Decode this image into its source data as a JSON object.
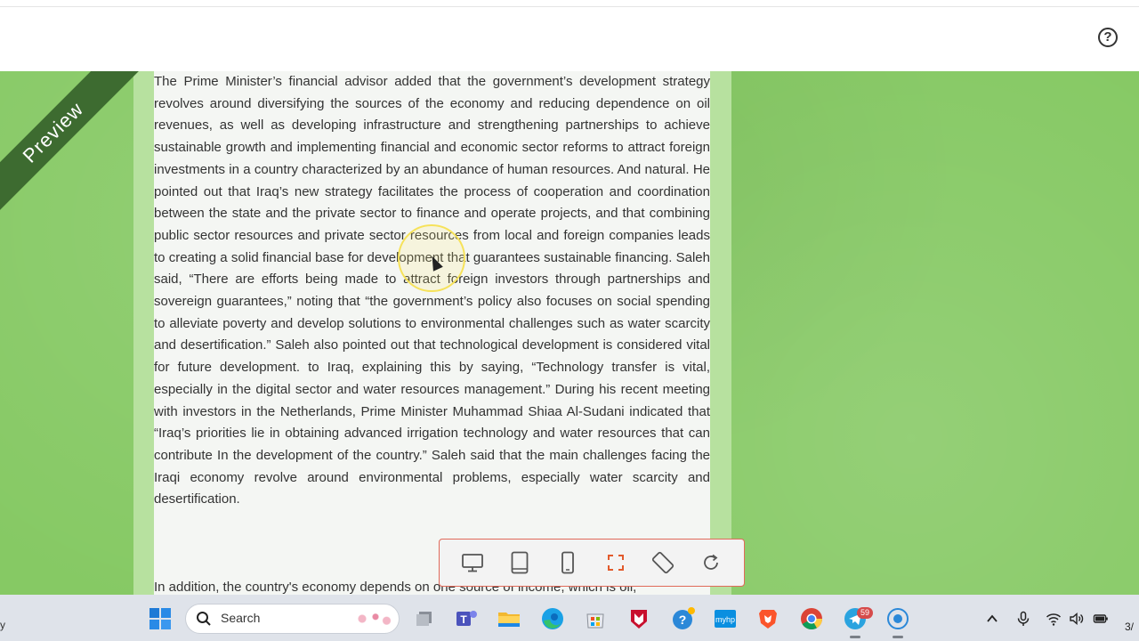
{
  "header": {
    "help_icon": "question-circle-icon",
    "help_glyph": "?"
  },
  "preview": {
    "ribbon_label": "Preview",
    "paragraph_1": "The Prime Minister’s financial advisor added that the government’s development strategy revolves around diversifying the sources of the economy and reducing dependence on oil revenues, as well as developing infrastructure and strengthening partnerships to achieve sustainable growth and implementing financial and economic sector reforms to attract foreign investments in a country characterized by an abundance of human resources. And natural. He pointed out that Iraq’s new strategy facilitates the process of cooperation and coordination between the state and the private sector to finance and operate projects, and that combining public sector resources and private sector resources from local and foreign companies leads to creating a solid financial base for development that guarantees sustainable financing. Saleh said, “There are efforts being made to attract foreign investors through partnerships and sovereign guarantees,” noting that “the government’s policy also focuses on social spending to alleviate poverty and develop solutions to environmental challenges such as water scarcity and desertification.” Saleh also pointed out that technological development is considered vital for future development. to Iraq, explaining this by saying, “Technology transfer is vital, especially in the digital sector and water resources management.” During his recent meeting with investors in the Netherlands, Prime Minister Muhammad Shiaa Al-Sudani indicated that “Iraq’s priorities lie in obtaining advanced irrigation technology and water resources that can contribute In the development of the country.” Saleh said that the main challenges facing the Iraqi economy revolve around environmental problems, especially water scarcity and desertification.",
    "paragraph_2": "In addition, the country's economy depends on one source of income, which is oil,"
  },
  "device_toolbar": {
    "buttons": [
      {
        "name": "desktop-view-button",
        "icon": "desktop-icon"
      },
      {
        "name": "tablet-view-button",
        "icon": "tablet-icon"
      },
      {
        "name": "mobile-view-button",
        "icon": "mobile-icon"
      },
      {
        "name": "fullscreen-button",
        "icon": "fullscreen-icon"
      },
      {
        "name": "rotate-button",
        "icon": "rotate-icon"
      },
      {
        "name": "refresh-button",
        "icon": "refresh-icon"
      }
    ]
  },
  "taskbar": {
    "left_clip_text": "y",
    "search_label": "Search",
    "apps": [
      {
        "name": "task-view",
        "icon": "task-view-icon"
      },
      {
        "name": "teams",
        "icon": "teams-icon"
      },
      {
        "name": "file-explorer",
        "icon": "folder-icon"
      },
      {
        "name": "edge",
        "icon": "edge-icon"
      },
      {
        "name": "microsoft-store",
        "icon": "store-icon"
      },
      {
        "name": "mcafee",
        "icon": "mcafee-icon"
      },
      {
        "name": "get-help",
        "icon": "help-icon"
      },
      {
        "name": "myhp",
        "icon": "myhp-icon"
      },
      {
        "name": "brave",
        "icon": "brave-icon"
      },
      {
        "name": "chrome",
        "icon": "chrome-icon"
      },
      {
        "name": "telegram",
        "icon": "telegram-icon"
      },
      {
        "name": "recorder",
        "icon": "record-icon"
      }
    ],
    "telegram_badge": "59",
    "tray_clock_clip": "3/"
  },
  "colors": {
    "canvas_green": "#86c964",
    "sheet_border": "#b7e19f",
    "ribbon": "#3d6b30",
    "toolbar_accent": "#e06a5a"
  }
}
